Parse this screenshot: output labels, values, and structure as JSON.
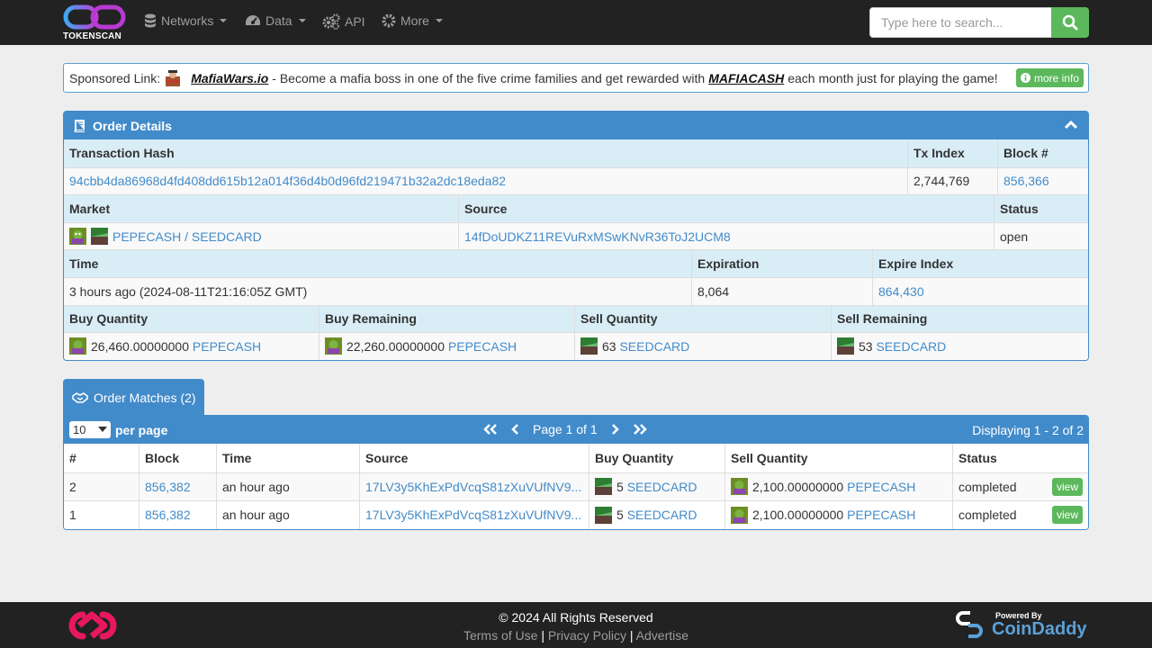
{
  "nav": {
    "brand": "TOKENSCAN",
    "items": [
      {
        "label": "Networks",
        "icon": "database-icon",
        "dropdown": true
      },
      {
        "label": "Data",
        "icon": "dashboard-icon",
        "dropdown": true
      },
      {
        "label": "API",
        "icon": "cogs-icon",
        "dropdown": false
      },
      {
        "label": "More",
        "icon": "gear-icon",
        "dropdown": true
      }
    ],
    "search_placeholder": "Type here to search..."
  },
  "sponsor": {
    "prefix": "Sponsored Link:",
    "name": "MafiaWars.io",
    "text1": "- Become a mafia boss in one of the five crime families and get rewarded with",
    "token": "MAFIACASH",
    "text2": "each month just for playing the game!",
    "more_info": "more info"
  },
  "order": {
    "title": "Order Details",
    "labels": {
      "tx_hash": "Transaction Hash",
      "tx_index": "Tx Index",
      "block": "Block #",
      "market": "Market",
      "source": "Source",
      "status": "Status",
      "time": "Time",
      "expiration": "Expiration",
      "expire_index": "Expire Index",
      "buy_qty": "Buy Quantity",
      "buy_rem": "Buy Remaining",
      "sell_qty": "Sell Quantity",
      "sell_rem": "Sell Remaining"
    },
    "tx_hash": "94cbb4da86968d4fd408dd615b12a014f36d4b0d96fd219471b32a2dc18eda82",
    "tx_index": "2,744,769",
    "block": "856,366",
    "market": "PEPECASH / SEEDCARD",
    "source": "14fDoUDKZ11REVuRxMSwKNvR36ToJ2UCM8",
    "status": "open",
    "time": "3 hours ago (2024-08-11T21:16:05Z GMT)",
    "expiration": "8,064",
    "expire_index": "864,430",
    "buy_qty_amount": "26,460.00000000",
    "buy_qty_asset": "PEPECASH",
    "buy_rem_amount": "22,260.00000000",
    "buy_rem_asset": "PEPECASH",
    "sell_qty_amount": "63",
    "sell_qty_asset": "SEEDCARD",
    "sell_rem_amount": "53",
    "sell_rem_asset": "SEEDCARD"
  },
  "matches": {
    "tab_label": "Order Matches (2)",
    "per_page_value": "10",
    "per_page_label": "per page",
    "page_text": "Page 1 of 1",
    "displaying": "Displaying 1 - 2 of 2",
    "columns": [
      "#",
      "Block",
      "Time",
      "Source",
      "Buy Quantity",
      "Sell Quantity",
      "Status"
    ],
    "rows": [
      {
        "num": "2",
        "block": "856,382",
        "time": "an hour ago",
        "source": "17LV3y5KhExPdVcqS81zXuVUfNV9...",
        "buy_amount": "5",
        "buy_asset": "SEEDCARD",
        "sell_amount": "2,100.00000000",
        "sell_asset": "PEPECASH",
        "status": "completed",
        "action": "view"
      },
      {
        "num": "1",
        "block": "856,382",
        "time": "an hour ago",
        "source": "17LV3y5KhExPdVcqS81zXuVUfNV9...",
        "buy_amount": "5",
        "buy_asset": "SEEDCARD",
        "sell_amount": "2,100.00000000",
        "sell_asset": "PEPECASH",
        "status": "completed",
        "action": "view"
      }
    ]
  },
  "footer": {
    "copyright": "© 2024 All Rights Reserved",
    "links": [
      "Terms of Use",
      "Privacy Policy",
      "Advertise"
    ],
    "powered_by": "Powered By",
    "powered_name": "CoinDaddy"
  },
  "colors": {
    "primary": "#428bca",
    "success": "#5cb85c",
    "navbar": "#222222"
  }
}
